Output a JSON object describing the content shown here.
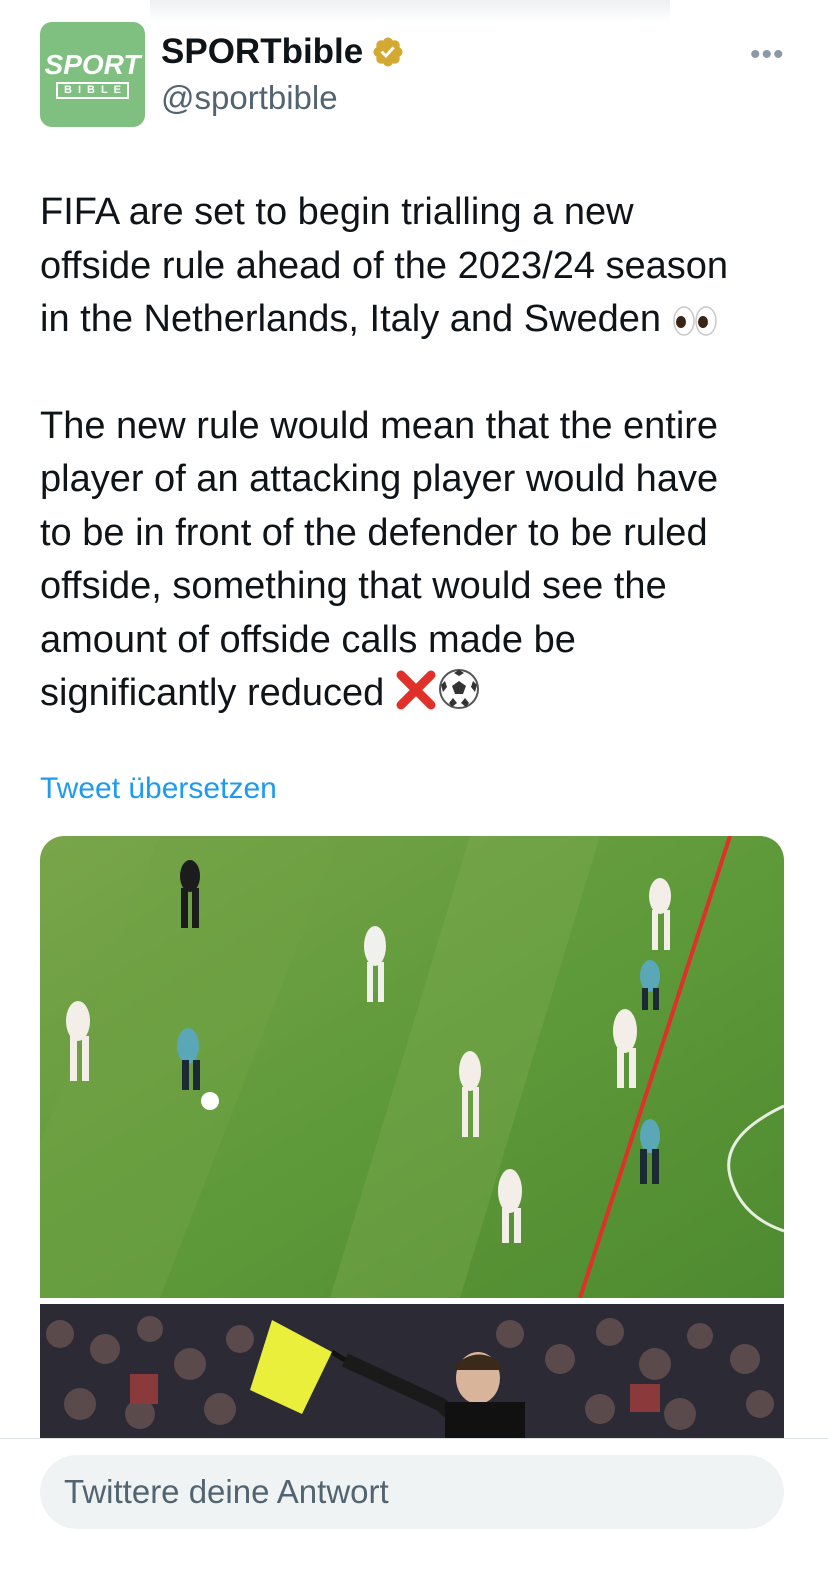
{
  "account": {
    "avatar_line1": "SPORT",
    "avatar_line2": "BIBLE",
    "name": "SPORTbible",
    "handle": "@sportbible",
    "verified_badge_color": "#d4a933"
  },
  "more_icon": "more-horizontal-icon",
  "tweet": {
    "paragraph1": "FIFA are set to begin trialling a new\noffside rule ahead of the 2023/24 season\nin the Netherlands, Italy and Sweden",
    "paragraph1_emoji": "eyes-emoji",
    "paragraph2": "The new rule would mean that the entire\nplayer of an attacking player would have\nto be in front of the defender to be ruled\noffside, something that would see the\namount of offside calls made be\nsignificantly reduced",
    "paragraph2_emoji": [
      "cross-mark-emoji",
      "soccer-ball-emoji"
    ]
  },
  "translate_label": "Tweet übersetzen",
  "reply_placeholder": "Twittere deine Antwort",
  "colors": {
    "link": "#1d9bf0",
    "secondary_text": "#536471",
    "avatar_bg": "#7fbf7f",
    "offside_line": "#e0302a"
  }
}
